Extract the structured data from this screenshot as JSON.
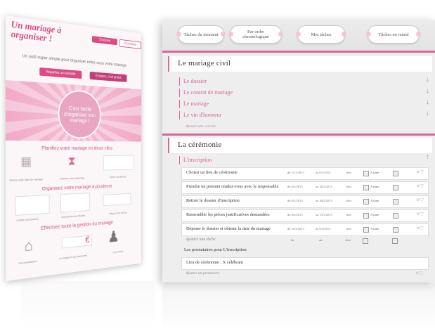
{
  "landing": {
    "title": "Un mariage à organiser !",
    "top_buttons": [
      "S'inscrire",
      "Connexion"
    ],
    "tagline": "Un outil super simple pour organiser entre vous votre mariage",
    "cta_buttons": [
      "Regardez un exemple",
      "Essayez, c'est gratuit"
    ],
    "hero_bubble": "C'est facile d'organiser son mariage !",
    "heading1": "Planifiez votre mariage en deux clics",
    "caps1": [
      "Entrez votre date de mariage",
      "Estimez votre planning",
      "Gérez vos tâches"
    ],
    "heading2": "Organisez votre mariage à plusieurs",
    "caps2": [
      "Invitez vos proches",
      "Commentez les tâches",
      "Affectez les tâches"
    ],
    "heading3": "Effectuez toute la gestion du mariage",
    "caps3": [
      "Vos prestataires",
      "Le budget et les paiements",
      "Les invités"
    ],
    "euro_symbol": "€"
  },
  "app": {
    "tabs": [
      "Tâches du moment",
      "Par ordre chronologique",
      "Mes tâches",
      "Tâches en retard"
    ],
    "sections": [
      {
        "title": "Le mariage civil",
        "items": [
          "Le dossier",
          "Le contrat de mariage",
          "Le mariage",
          "Le vin d'honneur"
        ],
        "add_label": "Ajouter une activité"
      },
      {
        "title": "La cérémonie",
        "open_item": "L'inscription"
      }
    ],
    "tasks": [
      {
        "title": "Choisir un lieu de cérémonie",
        "start": "du 11/2/2013",
        "end": "au 6/2/2013",
        "owner": "chez",
        "status": "A faire"
      },
      {
        "title": "Prendre un premier rendez-vous avec le responsable",
        "start": "du 6/2/2013",
        "end": "au 26/2/2013",
        "owner": "chez",
        "status": "A faire"
      },
      {
        "title": "Retirer le dossier d'inscription",
        "start": "du 6/2/2013",
        "end": "au 26/2/2013",
        "owner": "chez",
        "status": "A faire"
      },
      {
        "title": "Rassembler les pièces justificatives demandées",
        "start": "du 6/2/2013",
        "end": "au 15/3/2013",
        "owner": "chez",
        "status": "A faire"
      },
      {
        "title": "Déposer le dossier et obtenir la date du mariage",
        "start": "du 16/2/2013",
        "end": "au 6/4/2013",
        "owner": "chez",
        "status": "A faire"
      }
    ],
    "add_task": "Ajouter une tâche",
    "add_task_start": "du",
    "add_task_end": "au",
    "add_task_owner": "chez",
    "providers_heading": "Les prestataires pour L'inscription",
    "provider_row": "Lieu de cérémonie : X célébrant",
    "add_provider": "Ajouter un prestataire"
  }
}
